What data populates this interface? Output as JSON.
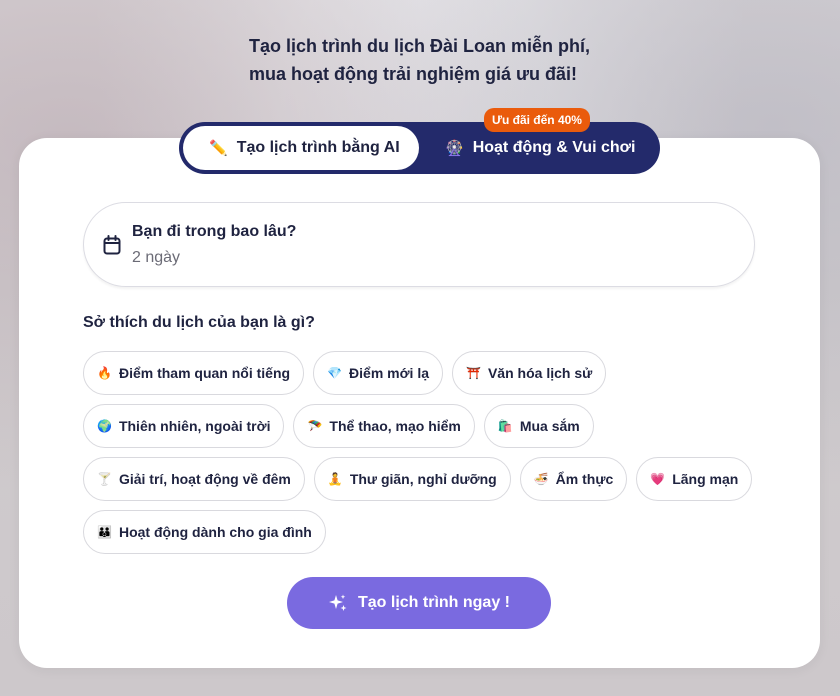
{
  "headline": {
    "line1": "Tạo lịch trình du lịch Đài Loan miễn phí,",
    "line2": "mua hoạt động trải nghiệm giá ưu đãi!"
  },
  "mode_toggle": {
    "ai_label": "Tạo lịch trình bằng AI",
    "ai_icon": "pencil-icon",
    "activities_label": "Hoạt động & Vui chơi",
    "activities_icon": "ferris-wheel-icon",
    "promo_badge": "Ưu đãi đến 40%"
  },
  "duration": {
    "question": "Bạn đi trong bao lâu?",
    "value": "2 ngày",
    "icon": "calendar-icon"
  },
  "interests": {
    "question": "Sở thích du lịch của bạn là gì?",
    "rows": [
      [
        {
          "emoji": "🔥",
          "label": "Điểm tham quan nổi tiếng",
          "icon": "fire-icon"
        },
        {
          "emoji": "💎",
          "label": "Điểm mới lạ",
          "icon": "gem-icon"
        },
        {
          "emoji": "⛩️",
          "label": "Văn hóa lịch sử",
          "icon": "torii-gate-icon"
        }
      ],
      [
        {
          "emoji": "🌍",
          "label": "Thiên nhiên, ngoài trời",
          "icon": "globe-icon"
        },
        {
          "emoji": "🪂",
          "label": "Thể thao, mạo hiểm",
          "icon": "parachute-icon"
        },
        {
          "emoji": "🛍️",
          "label": "Mua sắm",
          "icon": "shopping-bags-icon"
        }
      ],
      [
        {
          "emoji": "🍸",
          "label": "Giải trí, hoạt động về đêm",
          "icon": "cocktail-icon"
        },
        {
          "emoji": "🧘",
          "label": "Thư giãn, nghỉ dưỡng",
          "icon": "meditation-icon"
        },
        {
          "emoji": "🍜",
          "label": "Ẩm thực",
          "icon": "noodle-bowl-icon"
        },
        {
          "emoji": "💗",
          "label": "Lãng mạn",
          "icon": "heart-icon"
        }
      ],
      [
        {
          "emoji": "👪",
          "label": "Hoạt động dành cho gia đình",
          "icon": "family-icon"
        }
      ]
    ]
  },
  "cta": {
    "label": "Tạo lịch trình ngay !",
    "icon": "sparkles-icon"
  },
  "colors": {
    "navy": "#232a6b",
    "purple_cta": "#7a6ae0",
    "promo_orange": "#ea5b0c"
  }
}
